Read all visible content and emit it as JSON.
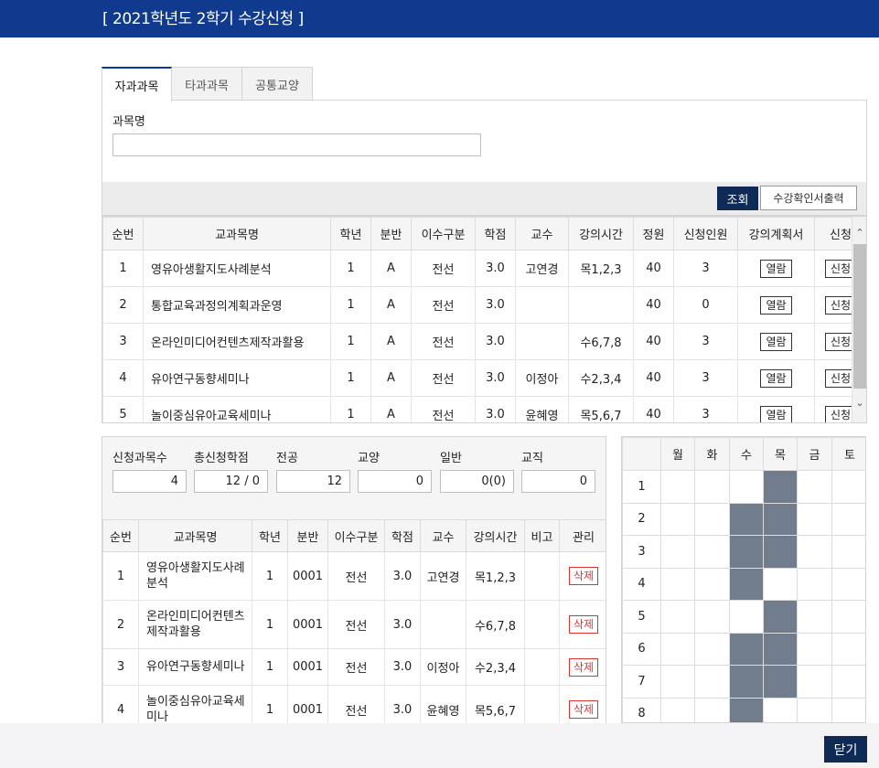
{
  "header": {
    "title": "[ 2021학년도 2학기 수강신청 ]"
  },
  "tabs": [
    {
      "label": "자과과목",
      "active": true
    },
    {
      "label": "타과과목",
      "active": false
    },
    {
      "label": "공통교양",
      "active": false
    }
  ],
  "search": {
    "field_label": "과목명",
    "value": ""
  },
  "actions": {
    "search_label": "조회",
    "print_label": "수강확인서출력"
  },
  "course_table": {
    "headers": [
      "순번",
      "교과목명",
      "학년",
      "분반",
      "이수구분",
      "학점",
      "교수",
      "강의시간",
      "정원",
      "신청인원",
      "강의계획서",
      "신청"
    ],
    "view_label": "열람",
    "apply_label": "신청",
    "rows": [
      {
        "no": "1",
        "name": "영유아생활지도사례분석",
        "year": "1",
        "section": "A",
        "type": "전선",
        "credit": "3.0",
        "prof": "고연경",
        "time": "목1,2,3",
        "cap": "40",
        "applied": "3"
      },
      {
        "no": "2",
        "name": "통합교육과정의계획과운영",
        "year": "1",
        "section": "A",
        "type": "전선",
        "credit": "3.0",
        "prof": "",
        "time": "",
        "cap": "40",
        "applied": "0"
      },
      {
        "no": "3",
        "name": "온라인미디어컨텐츠제작과활용",
        "year": "1",
        "section": "A",
        "type": "전선",
        "credit": "3.0",
        "prof": "",
        "time": "수6,7,8",
        "cap": "40",
        "applied": "3"
      },
      {
        "no": "4",
        "name": "유아연구동향세미나",
        "year": "1",
        "section": "A",
        "type": "전선",
        "credit": "3.0",
        "prof": "이정아",
        "time": "수2,3,4",
        "cap": "40",
        "applied": "3"
      },
      {
        "no": "5",
        "name": "놀이중심유아교육세미나",
        "year": "1",
        "section": "A",
        "type": "전선",
        "credit": "3.0",
        "prof": "윤혜영",
        "time": "목5,6,7",
        "cap": "40",
        "applied": "3"
      }
    ]
  },
  "summary": [
    {
      "label": "신청과목수",
      "value": "4"
    },
    {
      "label": "총신청학점",
      "value": "12 / 0"
    },
    {
      "label": "전공",
      "value": "12"
    },
    {
      "label": "교양",
      "value": "0"
    },
    {
      "label": "일반",
      "value": "0(0)"
    },
    {
      "label": "교직",
      "value": "0"
    }
  ],
  "registered_table": {
    "headers": [
      "순번",
      "교과목명",
      "학년",
      "분반",
      "이수구분",
      "학점",
      "교수",
      "강의시간",
      "비고",
      "관리"
    ],
    "delete_label": "삭제",
    "rows": [
      {
        "no": "1",
        "name_l1": "영유아생활지도사례",
        "name_l2": "분석",
        "year": "1",
        "section": "0001",
        "type": "전선",
        "credit": "3.0",
        "prof": "고연경",
        "time": "목1,2,3",
        "note": ""
      },
      {
        "no": "2",
        "name_l1": "온라인미디어컨텐츠",
        "name_l2": "제작과활용",
        "year": "1",
        "section": "0001",
        "type": "전선",
        "credit": "3.0",
        "prof": "",
        "time": "수6,7,8",
        "note": ""
      },
      {
        "no": "3",
        "name_l1": "유아연구동향세미나",
        "name_l2": "",
        "year": "1",
        "section": "0001",
        "type": "전선",
        "credit": "3.0",
        "prof": "이정아",
        "time": "수2,3,4",
        "note": ""
      },
      {
        "no": "4",
        "name_l1": "놀이중심유아교육세",
        "name_l2": "미나",
        "year": "1",
        "section": "0001",
        "type": "전선",
        "credit": "3.0",
        "prof": "윤혜영",
        "time": "목5,6,7",
        "note": ""
      }
    ]
  },
  "timetable": {
    "days": [
      "월",
      "화",
      "수",
      "목",
      "금",
      "토"
    ],
    "periods": [
      "1",
      "2",
      "3",
      "4",
      "5",
      "6",
      "7",
      "8"
    ],
    "filled": [
      [
        false,
        false,
        false,
        true,
        false,
        false
      ],
      [
        false,
        false,
        true,
        true,
        false,
        false
      ],
      [
        false,
        false,
        true,
        true,
        false,
        false
      ],
      [
        false,
        false,
        true,
        false,
        false,
        false
      ],
      [
        false,
        false,
        false,
        true,
        false,
        false
      ],
      [
        false,
        false,
        true,
        true,
        false,
        false
      ],
      [
        false,
        false,
        true,
        true,
        false,
        false
      ],
      [
        false,
        false,
        true,
        false,
        false,
        false
      ]
    ],
    "filled_color": "#717c8c"
  },
  "footer": {
    "close_label": "닫기"
  },
  "colors": {
    "header_bg": "#0f3a8e",
    "dark_button": "#0f2a55",
    "delete_red": "#dd3333"
  }
}
